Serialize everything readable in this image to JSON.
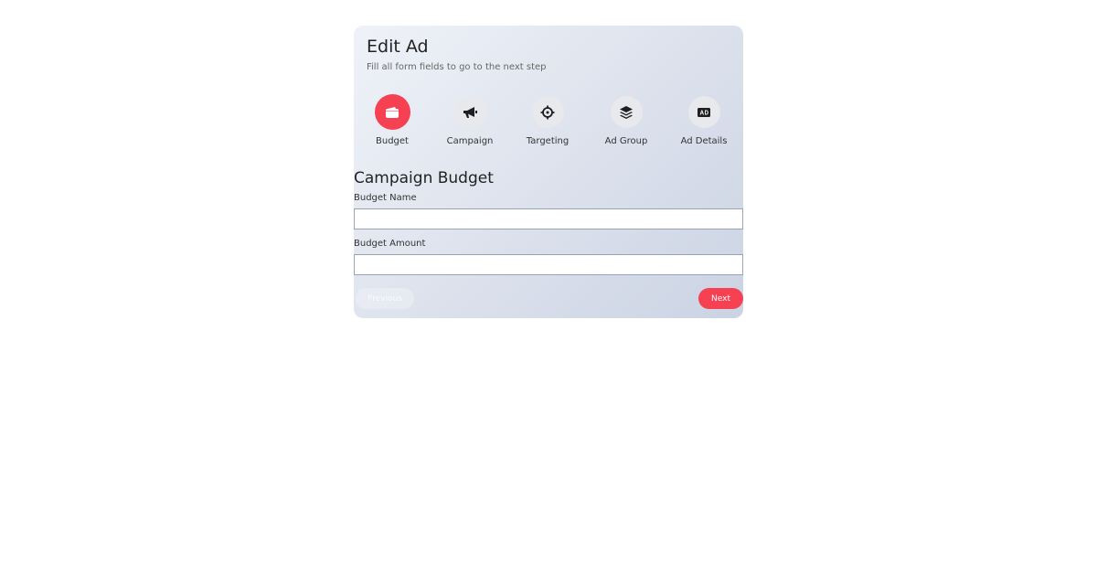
{
  "header": {
    "title": "Edit Ad",
    "subtitle": "Fill all form fields to go to the next step"
  },
  "steps": [
    {
      "label": "Budget",
      "icon": "wallet-icon",
      "active": true
    },
    {
      "label": "Campaign",
      "icon": "megaphone-icon",
      "active": false
    },
    {
      "label": "Targeting",
      "icon": "crosshair-icon",
      "active": false
    },
    {
      "label": "Ad Group",
      "icon": "layers-icon",
      "active": false
    },
    {
      "label": "Ad Details",
      "icon": "ad-icon",
      "active": false
    }
  ],
  "form": {
    "section_title": "Campaign Budget",
    "budget_name": {
      "label": "Budget Name",
      "value": "",
      "placeholder": ""
    },
    "budget_amount": {
      "label": "Budget Amount",
      "value": "",
      "placeholder": ""
    }
  },
  "buttons": {
    "previous": "Previous",
    "next": "Next"
  },
  "colors": {
    "accent": "#f64152",
    "step_inactive": "#e8e9ed"
  }
}
